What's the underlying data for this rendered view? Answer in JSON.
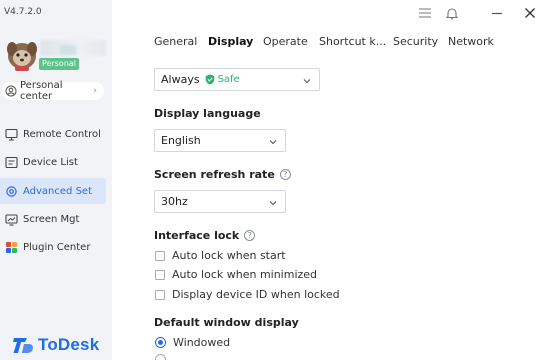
{
  "app": {
    "version": "V4.7.2.0",
    "badge": "Personal",
    "personal_center": "Personal center",
    "logo_text": "ToDesk"
  },
  "nav": [
    {
      "label": "Remote Control",
      "icon": "monitor-icon"
    },
    {
      "label": "Device List",
      "icon": "device-list-icon"
    },
    {
      "label": "Advanced Set",
      "icon": "settings-gear-icon",
      "active": true
    },
    {
      "label": "Screen Mgt",
      "icon": "screen-icon"
    },
    {
      "label": "Plugin Center",
      "icon": "plugin-grid-icon"
    }
  ],
  "titlebar": {
    "icons": [
      "menu-icon",
      "bell-icon",
      "minimize-icon",
      "close-icon"
    ]
  },
  "tabs": [
    {
      "label": "General"
    },
    {
      "label": "Display",
      "active": true
    },
    {
      "label": "Operate"
    },
    {
      "label": "Shortcut k..."
    },
    {
      "label": "Security"
    },
    {
      "label": "Network"
    }
  ],
  "settings": {
    "top_select": {
      "value": "Always",
      "tag": "Safe"
    },
    "display_language": {
      "title": "Display language",
      "value": "English"
    },
    "refresh_rate": {
      "title": "Screen refresh rate",
      "help": "?",
      "value": "30hz"
    },
    "interface_lock": {
      "title": "Interface lock",
      "help": "?",
      "options": [
        "Auto lock when start",
        "Auto lock when minimized",
        "Display device ID when locked"
      ]
    },
    "default_window": {
      "title": "Default window display",
      "options": [
        {
          "label": "Windowed",
          "selected": true
        }
      ]
    }
  },
  "colors": {
    "accent": "#2a6ae8",
    "safe_green": "#2fb36d",
    "sidebar_bg": "#f2f3f7",
    "active_nav_bg": "#dbe6fb"
  }
}
